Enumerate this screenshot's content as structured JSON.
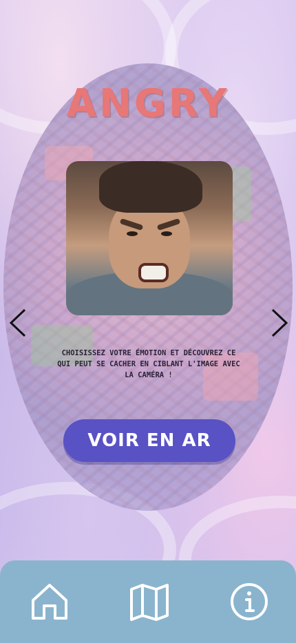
{
  "header": {
    "emotion_title": "ANGRY"
  },
  "carousel": {
    "image_subject": "angry man portrait",
    "prev_icon": "chevron-left-icon",
    "next_icon": "chevron-right-icon"
  },
  "caption": {
    "text": "Choisissez votre émotion et découvrez ce qui peut se cacher en ciblant l'image avec la caméra !"
  },
  "cta": {
    "label": "VOIR EN AR"
  },
  "navbar": {
    "items": [
      {
        "icon": "home-icon"
      },
      {
        "icon": "map-icon"
      },
      {
        "icon": "info-icon"
      }
    ]
  },
  "colors": {
    "title": "#e87777",
    "button": "#5952c4",
    "navbar": "#8ab4cd",
    "text": "#2b2238"
  }
}
